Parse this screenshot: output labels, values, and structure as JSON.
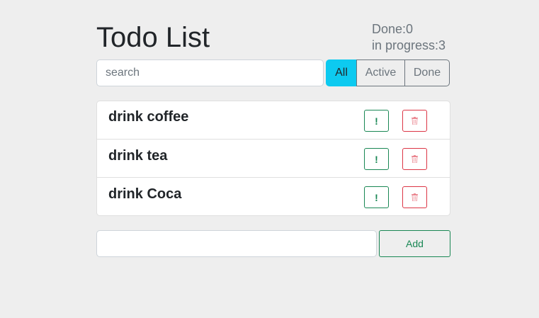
{
  "header": {
    "title": "Todo List",
    "done_label": "Done:0",
    "in_progress_label": "in progress:3"
  },
  "search": {
    "placeholder": "search",
    "value": ""
  },
  "filters": {
    "all": "All",
    "active": "Active",
    "done": "Done",
    "selected": "All",
    "selected_color": "#0dcaf0"
  },
  "todos": [
    {
      "label": "drink coffee",
      "important_label": "!",
      "delete_icon": "trash-icon"
    },
    {
      "label": "drink tea",
      "important_label": "!",
      "delete_icon": "trash-icon"
    },
    {
      "label": "drink Coca",
      "important_label": "!",
      "delete_icon": "trash-icon"
    }
  ],
  "add_form": {
    "value": "",
    "button_label": "Add"
  },
  "colors": {
    "background": "#eeeeee",
    "success": "#198754",
    "danger": "#dc3545"
  }
}
